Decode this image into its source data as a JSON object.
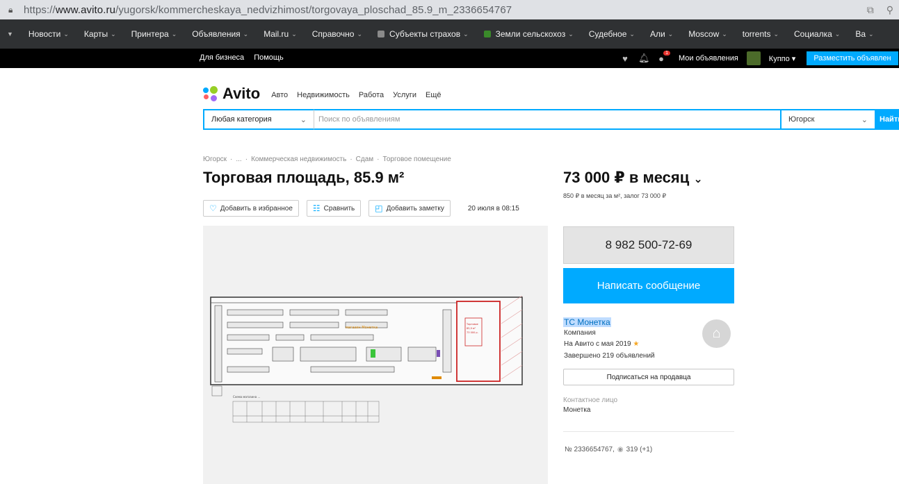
{
  "browser": {
    "url_prefix": "https://",
    "url_host": "www.avito.ru",
    "url_path": "/yugorsk/kommercheskaya_nedvizhimost/torgovaya_ploschad_85.9_m_2336654767"
  },
  "bookmarks": [
    {
      "label": "Новости",
      "color": ""
    },
    {
      "label": "Карты",
      "color": ""
    },
    {
      "label": "Принтера",
      "color": ""
    },
    {
      "label": "Объявления",
      "color": ""
    },
    {
      "label": "Mail.ru",
      "color": ""
    },
    {
      "label": "Справочно",
      "color": ""
    },
    {
      "label": "Субъекты страхов",
      "color": "#8a8a8a"
    },
    {
      "label": "Земли сельскохоз",
      "color": "#3a8a2a"
    },
    {
      "label": "Судебное",
      "color": ""
    },
    {
      "label": "Али",
      "color": ""
    },
    {
      "label": "Moscow",
      "color": ""
    },
    {
      "label": "torrents",
      "color": ""
    },
    {
      "label": "Социалка",
      "color": ""
    },
    {
      "label": "Ва",
      "color": ""
    }
  ],
  "topbar": {
    "for_business": "Для бизнеса",
    "help": "Помощь",
    "notifications_count": "1",
    "my_ads": "Мои объявления",
    "user": "Куппо",
    "post_ad": "Разместить объявлен"
  },
  "header": {
    "logo": "Avito",
    "nav": [
      "Авто",
      "Недвижимость",
      "Работа",
      "Услуги",
      "Ещё"
    ]
  },
  "search": {
    "category": "Любая категория",
    "placeholder": "Поиск по объявлениям",
    "city": "Югорск",
    "find": "Найти"
  },
  "breadcrumbs": [
    "Югорск",
    "...",
    "Коммерческая недвижимость",
    "Сдам",
    "Торговое помещение"
  ],
  "listing": {
    "title": "Торговая площадь, 85.9 м²",
    "price": "73 000 ₽ в месяц",
    "price_sub": "850 ₽ в месяц за м², залог 73 000 ₽",
    "add_favorite": "Добавить в избранное",
    "compare": "Сравнить",
    "add_note": "Добавить заметку",
    "date": "20 июля в 08:15",
    "id_text": "№ 2336654767,",
    "views": "319 (+1)"
  },
  "plan_caption": "Схема магазина ...",
  "seller": {
    "phone": "8 982 500-72-69",
    "write": "Написать сообщение",
    "name": "ТС Монетка",
    "type": "Компания",
    "since": "На Авито с мая 2019",
    "completed": "Завершено 219 объявлений",
    "subscribe": "Подписаться на продавца",
    "contact_label": "Контактное лицо",
    "contact_name": "Монетка"
  },
  "colors": {
    "accent": "#00aaff",
    "top_strip": "#000000",
    "bookmarks_bg": "#2f3133",
    "plan_highlight": "#cc2222"
  }
}
